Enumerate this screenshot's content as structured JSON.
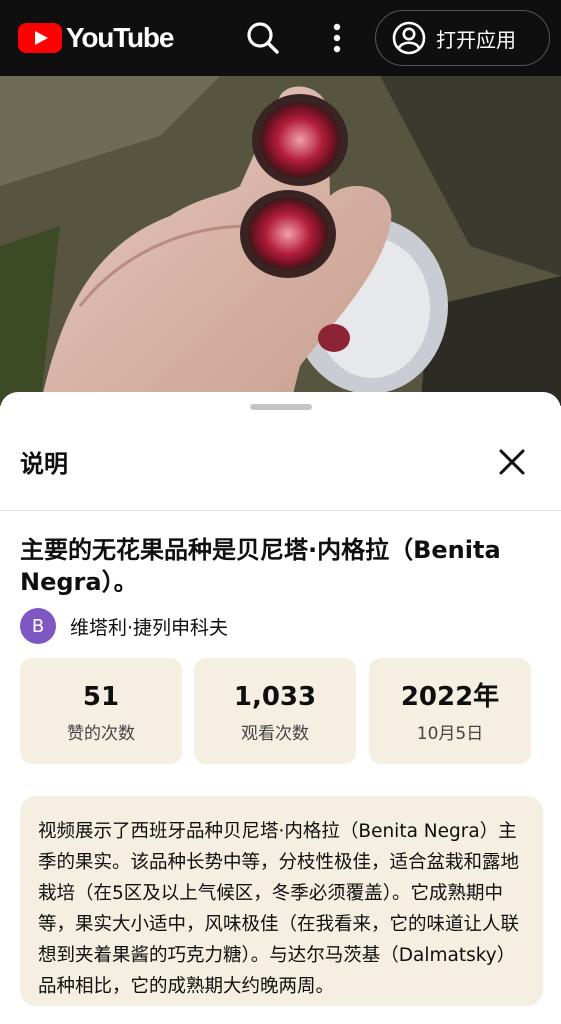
{
  "header": {
    "logo_text": "YouTube",
    "open_app_label": "打开应用"
  },
  "sheet": {
    "title": "说明"
  },
  "video": {
    "title": "主要的无花果品种是贝尼塔·内格拉（Benita Negra）。",
    "channel": {
      "avatar_letter": "B",
      "name": "维塔利·捷列申科夫",
      "avatar_color": "#7e57c2"
    },
    "stats": [
      {
        "value": "51",
        "label": "赞的次数"
      },
      {
        "value": "1,033",
        "label": "观看次数"
      },
      {
        "value": "2022年",
        "label": "10月5日"
      }
    ],
    "description": "视频展示了西班牙品种贝尼塔·内格拉（Benita Negra）主季的果实。该品种长势中等，分枝性极佳，适合盆栽和露地栽培（在5区及以上气候区，冬季必须覆盖）。它成熟期中等，果实大小适中，风味极佳（在我看来，它的味道让人联想到夹着果酱的巧克力糖）。与达尔马茨基（Dalmatsky）品种相比，它的成熟期大约晚两周。"
  },
  "colors": {
    "brand_red": "#ff0000",
    "topbar_bg": "#0f0f0f",
    "card_bg": "#f5efe1"
  },
  "icons": [
    "youtube-logo-icon",
    "search-icon",
    "more-vert-icon",
    "account-circle-icon",
    "close-icon"
  ]
}
